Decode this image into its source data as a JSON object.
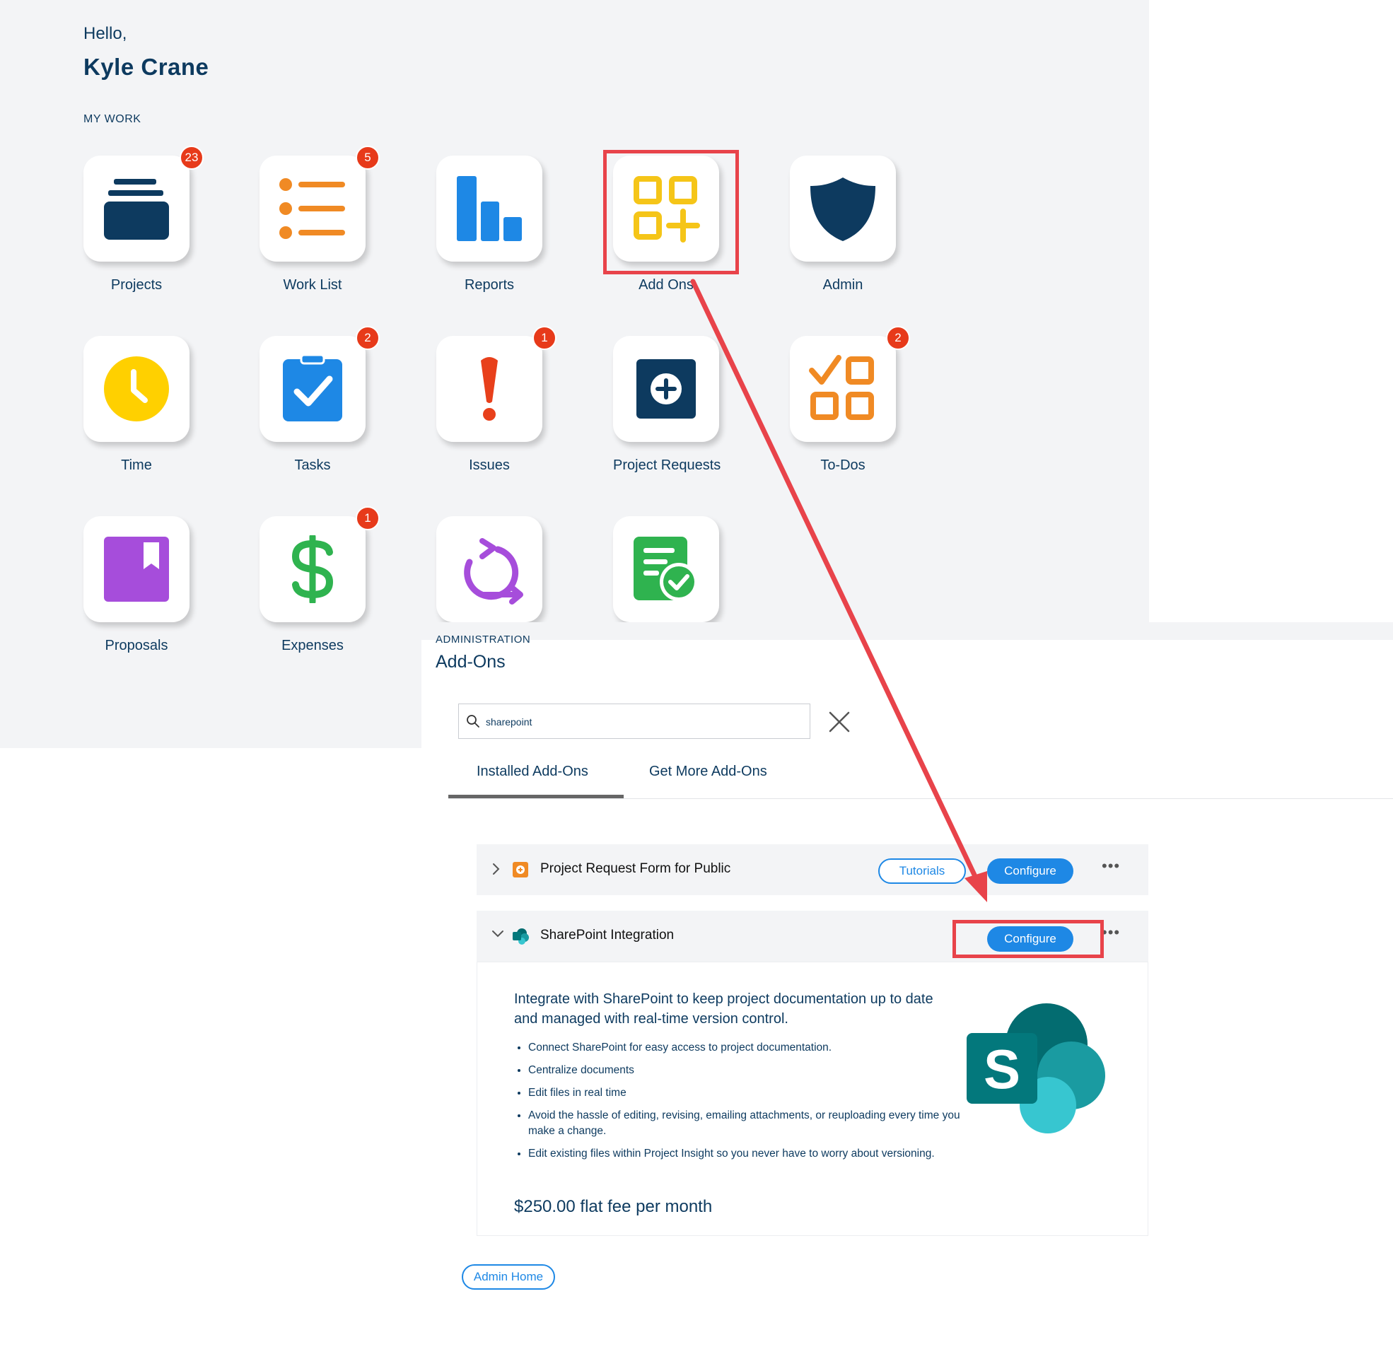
{
  "greeting": "Hello,",
  "user_name": "Kyle Crane",
  "section_label": "MY WORK",
  "tiles": [
    {
      "label": "Projects",
      "badge": "23",
      "icon": "projects-stack-icon"
    },
    {
      "label": "Work List",
      "badge": "5",
      "icon": "list-icon"
    },
    {
      "label": "Reports",
      "badge": "",
      "icon": "bar-chart-icon"
    },
    {
      "label": "Add Ons",
      "badge": "",
      "icon": "add-ons-grid-icon"
    },
    {
      "label": "Admin",
      "badge": "",
      "icon": "shield-icon"
    },
    {
      "label": "Time",
      "badge": "",
      "icon": "clock-icon"
    },
    {
      "label": "Tasks",
      "badge": "2",
      "icon": "clipboard-check-icon"
    },
    {
      "label": "Issues",
      "badge": "1",
      "icon": "exclamation-icon"
    },
    {
      "label": "Project Requests",
      "badge": "",
      "icon": "plus-square-icon"
    },
    {
      "label": "To-Dos",
      "badge": "2",
      "icon": "todo-grid-icon"
    },
    {
      "label": "Proposals",
      "badge": "",
      "icon": "bookmark-book-icon"
    },
    {
      "label": "Expenses",
      "badge": "1",
      "icon": "dollar-icon"
    },
    {
      "label": "",
      "badge": "",
      "icon": "cycle-arrow-icon"
    },
    {
      "label": "",
      "badge": "",
      "icon": "document-check-icon"
    }
  ],
  "addons": {
    "breadcrumb": "ADMINISTRATION",
    "title": "Add-Ons",
    "search_value": "sharepoint",
    "tabs": {
      "installed": "Installed Add-Ons",
      "more": "Get More Add-Ons"
    },
    "rows": [
      {
        "title": "Project Request Form for Public",
        "tutorials": "Tutorials",
        "configure": "Configure",
        "more": "•••"
      },
      {
        "title": "SharePoint Integration",
        "configure": "Configure",
        "more": "•••"
      }
    ],
    "detail": {
      "description": "Integrate with SharePoint to keep project documentation up to date and managed with real-time version control.",
      "bullets": [
        "Connect SharePoint for easy access to project documentation.",
        "Centralize documents",
        "Edit files in real time",
        "Avoid the hassle of editing, revising, emailing attachments, or reuploading every time you make a change.",
        "Edit existing files within Project Insight so you never have to worry about versioning."
      ],
      "price": "$250.00 flat fee per month",
      "logo_letter": "S"
    },
    "admin_home": "Admin Home"
  },
  "colors": {
    "navy": "#0d3a5f",
    "blue": "#1e88e5",
    "badge_red": "#e73a1a",
    "annotation_red": "#e8434a"
  }
}
